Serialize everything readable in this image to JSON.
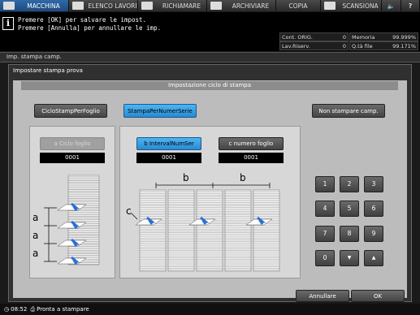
{
  "tabs": [
    {
      "label": "MACCHINA",
      "active": true,
      "icon": "copier-icon"
    },
    {
      "label": "ELENCO LAVORI",
      "active": false,
      "icon": "list-icon"
    },
    {
      "label": "RICHIAMARE",
      "active": false,
      "icon": "recall-icon"
    },
    {
      "label": "ARCHIVIARE",
      "active": false,
      "icon": "store-icon"
    },
    {
      "label": "COPIA",
      "active": false,
      "icon": "copy-icon"
    },
    {
      "label": "SCANSIONA",
      "active": false,
      "icon": "scan-icon"
    }
  ],
  "message": {
    "line1": "Premere [OK] per salvare le impost.",
    "line2": "Premere [Annulla] per annullare le imp."
  },
  "status": {
    "cont_orig_label": "Cont. ORIG.",
    "cont_orig_value": "0",
    "memoria_label": "Memoria",
    "memoria_value": "99.999%",
    "lav_riserv_label": "Lav.Riserv.",
    "lav_riserv_value": "0",
    "qta_file_label": "Q.tà file",
    "qta_file_value": "99.171%"
  },
  "breadcrumb": "Imp. stampa camp.",
  "panel_title": "Impostare stampa prova",
  "section_title": "Impostazione ciclo di stampa",
  "mode_buttons": {
    "per_foglio": "CicloStampPerFoglio",
    "per_numer_serie": "StampaPerNumerSerie",
    "non_stampare": "Non stampare camp."
  },
  "fields": {
    "a_label": "a Ciclo foglio",
    "a_value": "0001",
    "b_label": "b IntervalNumSer",
    "b_value": "0001",
    "c_label": "c numero foglio",
    "c_value": "0001"
  },
  "diagram_labels": {
    "a": "a",
    "b": "b",
    "c": "c"
  },
  "keypad": [
    "1",
    "2",
    "3",
    "4",
    "5",
    "6",
    "7",
    "8",
    "9",
    "0",
    "▼",
    "▲"
  ],
  "footer": {
    "cancel": "Annullare",
    "ok": "OK"
  },
  "bottom_bar": {
    "time": "08:52",
    "status": "Pronta a stampare"
  },
  "colors": {
    "selected": "#3aa0e8",
    "tab_active": "#2f6aa8"
  }
}
